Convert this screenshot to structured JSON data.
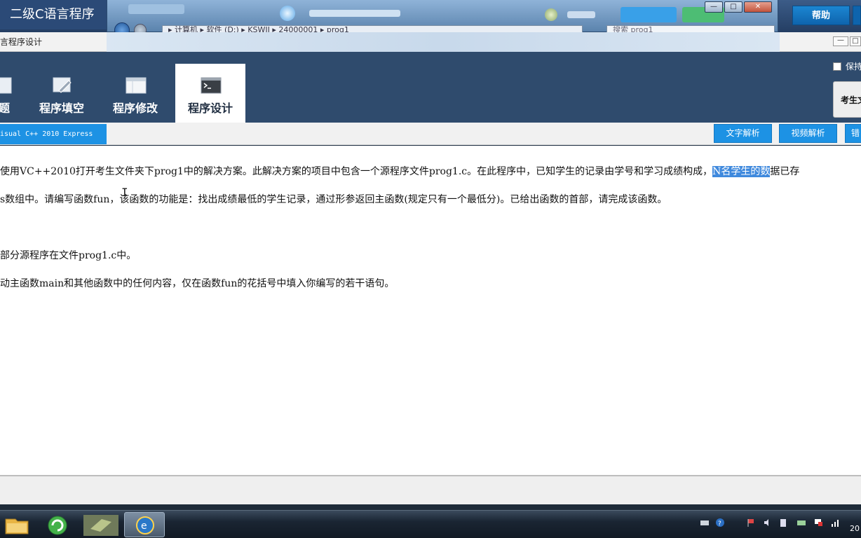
{
  "titlebar": {
    "app_title": "二级C语言程序",
    "help_label": "帮助",
    "controls": {
      "minimize": "—",
      "maximize": "□",
      "close": "✕"
    }
  },
  "overlay": {
    "address": "▸ 计算机 ▸ 软件 (D:) ▸ KSWJJ ▸ 24000001 ▸ prog1",
    "search_placeholder": "搜索 prog1"
  },
  "window": {
    "caption": "言程序设计"
  },
  "tabs": [
    {
      "label": "题",
      "icon": "question-icon",
      "active": false
    },
    {
      "label": "程序填空",
      "icon": "edit-icon",
      "active": false
    },
    {
      "label": "程序修改",
      "icon": "window-icon",
      "active": false
    },
    {
      "label": "程序设计",
      "icon": "terminal-icon",
      "active": true
    }
  ],
  "ribbon_right": {
    "keep_label": "保持",
    "exam_folder_label": "考生文"
  },
  "toolbar": {
    "vc_label": "isual C++ 2010 Express",
    "text_analysis": "文字解析",
    "video_analysis": "视频解析",
    "error_partial": "错"
  },
  "content": {
    "para1_pre": "使用VC++2010打开考生文件夹下prog1中的解决方案。此解决方案的项目中包含一个源程序文件prog1.c。在此程序中，已知学生的记录由学号和学习成绩构成，",
    "para1_sel": "N名学生的数",
    "para1_post": "据已存",
    "para2": "s数组中。请编写函数fun，该函数的功能是：找出成绩最低的学生记录，通过形参返回主函数(规定只有一个最低分)。已给出函数的首部，请完成该函数。",
    "para3": "部分源程序在文件prog1.c中。",
    "para4": "动主函数main和其他函数中的任何内容，仅在函数fun的花括号中填入你编写的若干语句。"
  },
  "taskbar": {
    "apps": [
      "folder-icon",
      "refresh-icon",
      "app-icon",
      "ie-icon"
    ],
    "clock": "20"
  },
  "colors": {
    "ribbon": "#2f4b6d",
    "accent_blue": "#1d92e4",
    "selection": "#3f89dd"
  }
}
